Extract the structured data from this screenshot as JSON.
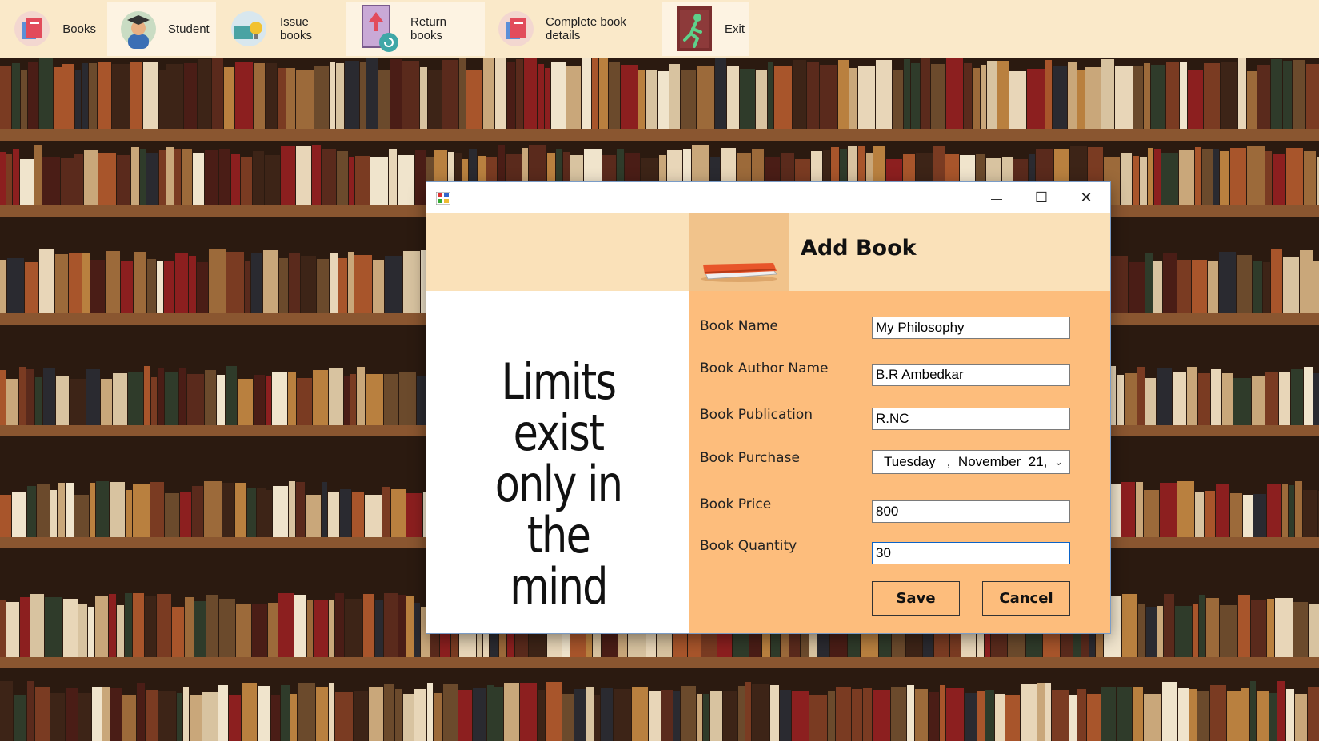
{
  "menu": [
    {
      "label": "Books",
      "icon": "books-icon"
    },
    {
      "label": "Student",
      "icon": "student-icon"
    },
    {
      "label": "Issue books",
      "icon": "issue-books-icon"
    },
    {
      "label": "Return books",
      "icon": "return-books-icon"
    },
    {
      "label": "Complete book details",
      "icon": "book-details-icon"
    },
    {
      "label": "Exit",
      "icon": "exit-icon"
    }
  ],
  "dialog": {
    "window_controls": {
      "minimize": "—",
      "maximize": "☐",
      "close": "✕"
    },
    "title": "Add Book",
    "quote": [
      "Limits",
      "exist",
      "only in",
      "the mind"
    ],
    "form": {
      "book_name_label": "Book Name",
      "book_name_value": "My Philosophy",
      "author_label": "Book Author Name",
      "author_value": "B.R Ambedkar",
      "publication_label": "Book Publication",
      "publication_value": "R.NC",
      "purchase_label": "Book Purchase",
      "purchase_value": "Tuesday   ,  November  21,",
      "price_label": "Book Price",
      "price_value": "800",
      "quantity_label": "Book Quantity",
      "quantity_value": "30",
      "save_label": "Save",
      "cancel_label": "Cancel"
    }
  },
  "colors": {
    "menubar": "#fae9c9",
    "header": "#fae1b9",
    "form_panel": "#fdbd7c",
    "header_icon_box": "#f1c38b",
    "focus_border": "#0a63c9"
  }
}
